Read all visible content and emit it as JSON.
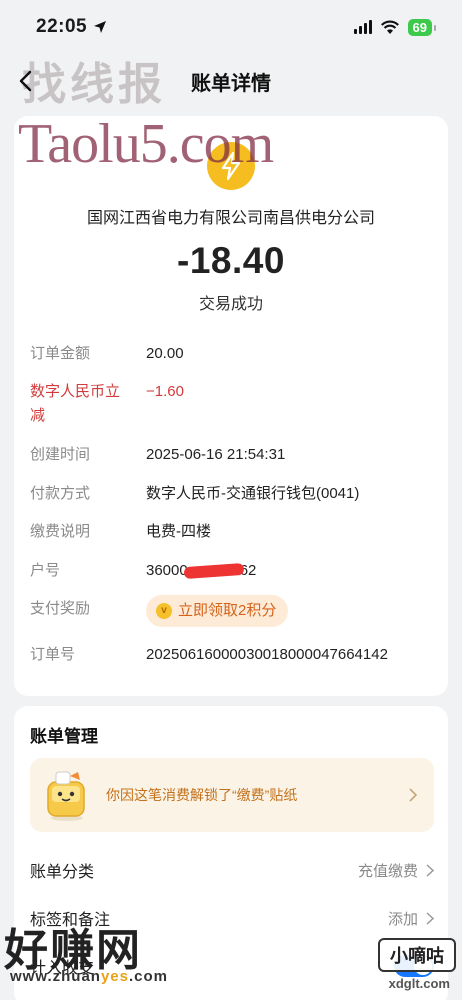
{
  "status_bar": {
    "time": "22:05",
    "battery": "69"
  },
  "nav": {
    "title": "账单详情"
  },
  "watermarks": {
    "top_cn": "找线报",
    "taolu": "Taolu5.com",
    "bottom_cn": "好赚网",
    "bottom_url_pre": "www.zhuan",
    "bottom_url_hl": "yes",
    "bottom_url_post": ".com",
    "right_badge": "小嘀咕",
    "right_url": "xdglt.com"
  },
  "transaction": {
    "merchant": "国网江西省电力有限公司南昌供电分公司",
    "amount": "-18.40",
    "status": "交易成功"
  },
  "details": {
    "order_amount_label": "订单金额",
    "order_amount": "20.00",
    "ecny_discount_label_1": "数字人民币立",
    "ecny_discount_label_2": "减",
    "ecny_discount": "−1.60",
    "created_label": "创建时间",
    "created": "2025-06-16 21:54:31",
    "payment_label": "付款方式",
    "payment": "数字人民币-交通银行钱包(0041)",
    "note_label": "缴费说明",
    "note": "电费-四楼",
    "account_label": "户号",
    "account_prefix": "36000",
    "account_suffix": "62",
    "reward_label": "支付奖励",
    "reward_button": "立即领取2积分",
    "order_no_label": "订单号",
    "order_no": "20250616000030018000047664142"
  },
  "management": {
    "title": "账单管理",
    "sticker_text": "你因这笔消费解锁了“缴费”贴纸",
    "category_label": "账单分类",
    "category_value": "充值缴费",
    "tags_label": "标签和备注",
    "tags_value": "添加",
    "budget_label": "计入收支"
  }
}
